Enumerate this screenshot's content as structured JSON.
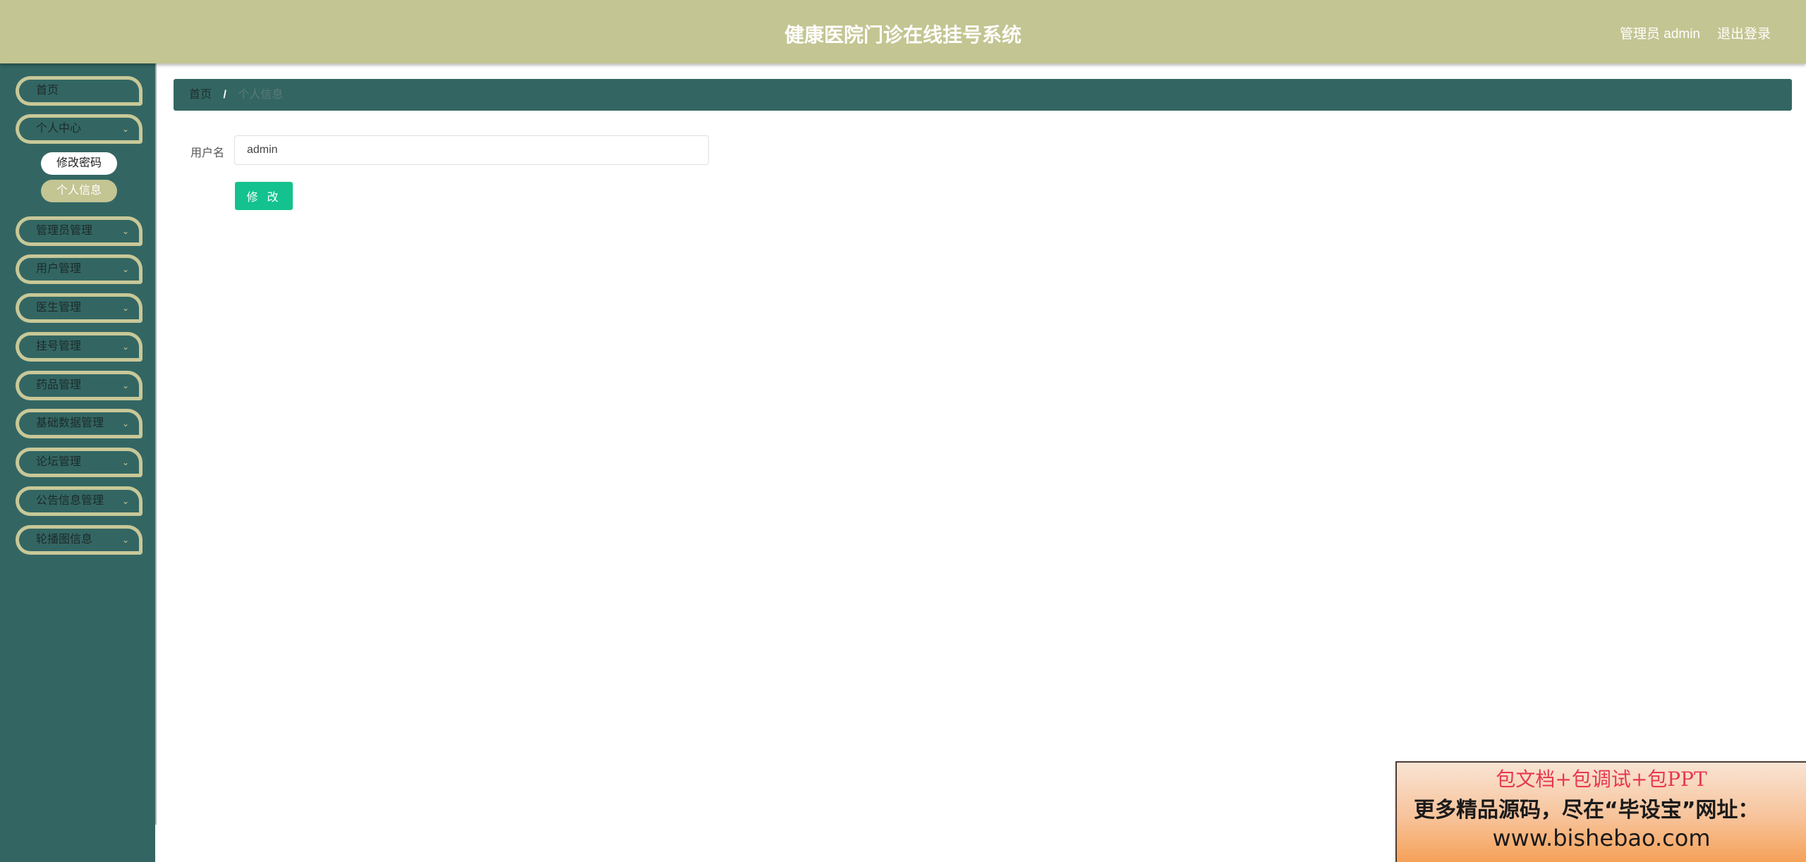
{
  "header": {
    "title": "健康医院门诊在线挂号系统",
    "admin_label": "管理员 admin",
    "logout_label": "退出登录"
  },
  "sidebar": {
    "items": [
      {
        "label": "首页",
        "has_chevron": false
      },
      {
        "label": "个人中心",
        "has_chevron": true,
        "expanded": true
      },
      {
        "label": "管理员管理",
        "has_chevron": true
      },
      {
        "label": "用户管理",
        "has_chevron": true
      },
      {
        "label": "医生管理",
        "has_chevron": true
      },
      {
        "label": "挂号管理",
        "has_chevron": true
      },
      {
        "label": "药品管理",
        "has_chevron": true
      },
      {
        "label": "基础数据管理",
        "has_chevron": true
      },
      {
        "label": "论坛管理",
        "has_chevron": true
      },
      {
        "label": "公告信息管理",
        "has_chevron": true
      },
      {
        "label": "轮播图信息",
        "has_chevron": true
      }
    ],
    "sub_items": [
      {
        "label": "修改密码",
        "active": false
      },
      {
        "label": "个人信息",
        "active": true
      }
    ],
    "chevron_icon": "chevron-down-icon"
  },
  "breadcrumb": {
    "home": "首页",
    "separator": "/",
    "current": "个人信息"
  },
  "form": {
    "username_label": "用户名",
    "username_value": "admin",
    "submit_label": "修 改"
  },
  "ad_banner": {
    "line1": "包文档+包调试+包PPT",
    "line2": "更多精品源码，尽在“毕设宝”网址：",
    "line3": "www.bishebao.com"
  },
  "colors": {
    "header_bg": "#c3c592",
    "sidebar_bg": "#336663",
    "menu_border": "#c8c898",
    "button_bg": "#13c28e"
  }
}
